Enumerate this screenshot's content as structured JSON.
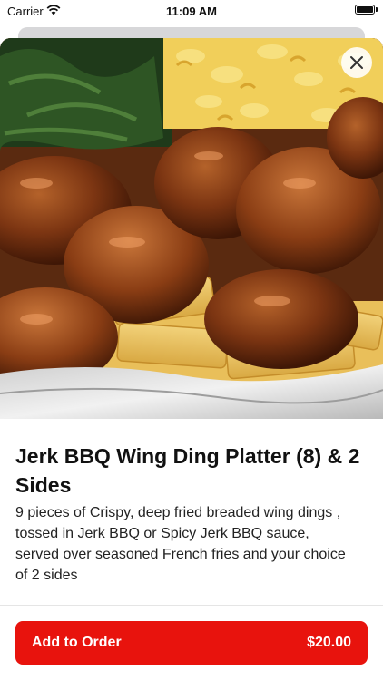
{
  "status_bar": {
    "carrier": "Carrier",
    "time": "11:09 AM"
  },
  "hero": {
    "image_subject": "food-photo-wings-fries-mac-and-cheese-greens"
  },
  "close_button": {
    "icon": "close-icon"
  },
  "item": {
    "title": "Jerk BBQ Wing Ding Platter (8) & 2 Sides",
    "description": "9 pieces of Crispy, deep fried breaded wing dings , tossed in Jerk BBQ or Spicy Jerk BBQ sauce, served over seasoned French fries and your choice of 2 sides"
  },
  "add_to_order": {
    "label": "Add to Order",
    "price": "$20.00"
  },
  "colors": {
    "accent": "#e8130d",
    "text": "#111111"
  }
}
